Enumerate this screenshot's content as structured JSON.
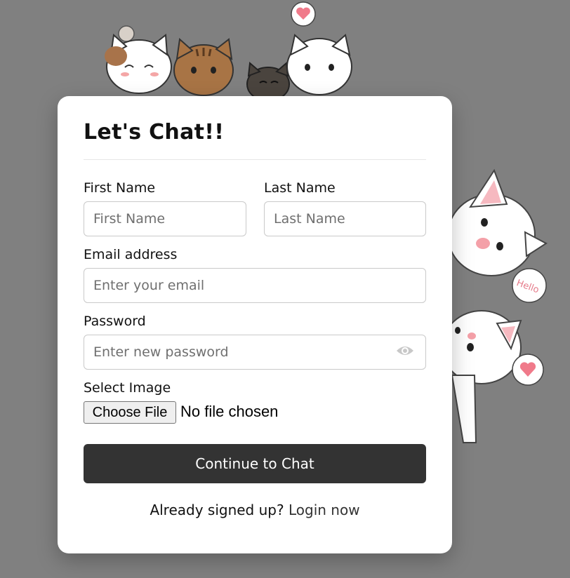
{
  "form": {
    "title": "Let's Chat!!",
    "first_name": {
      "label": "First Name",
      "placeholder": "First Name",
      "value": ""
    },
    "last_name": {
      "label": "Last Name",
      "placeholder": "Last Name",
      "value": ""
    },
    "email": {
      "label": "Email address",
      "placeholder": "Enter your email",
      "value": ""
    },
    "password": {
      "label": "Password",
      "placeholder": "Enter new password",
      "value": "",
      "toggle_icon": "eye-icon"
    },
    "image": {
      "label": "Select Image",
      "button_label": "Choose File",
      "status": "No file chosen"
    },
    "submit_label": "Continue to Chat",
    "footer": {
      "prompt": "Already signed up?",
      "link_label": "Login now"
    }
  },
  "decorations": {
    "illustration": "cartoon-cats",
    "speech_bubble_text": "Hello"
  },
  "colors": {
    "page_background": "#808080",
    "card_background": "#ffffff",
    "button_background": "#333333",
    "heart": "#f07a8a"
  }
}
